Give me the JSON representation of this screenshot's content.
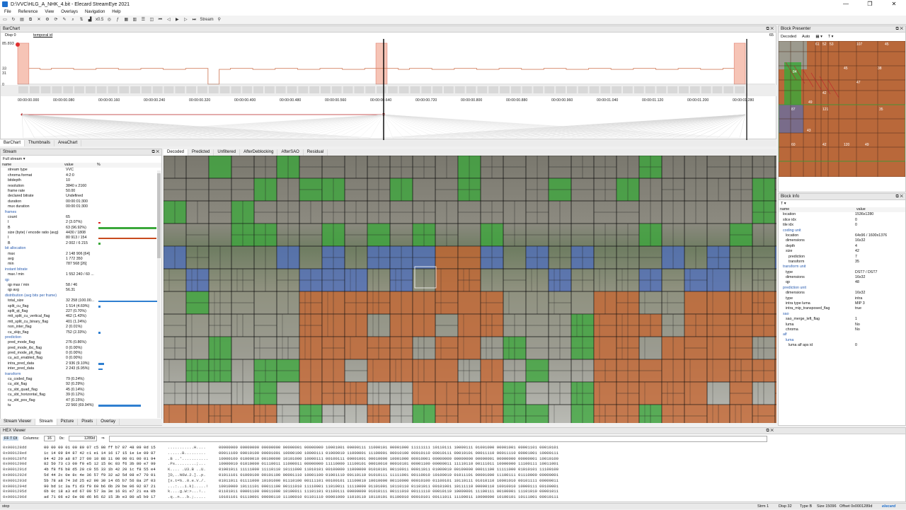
{
  "window": {
    "title": "D:\\VVC\\HLG_A_NHK_4.bit - Elecard StreamEye 2021",
    "controls": [
      "—",
      "❐",
      "✕"
    ]
  },
  "menu": [
    "File",
    "Reference",
    "View",
    "Overlays",
    "Navigation",
    "Help"
  ],
  "toolbar": {
    "zoom": "x0.5",
    "stream_label": "Stream"
  },
  "barchart": {
    "pane_title": "BarChart",
    "disp_label": "Disp 0",
    "series_label": "temporal id",
    "y_ticks": [
      "85.893",
      "33",
      "31",
      "0"
    ],
    "right_label": "65",
    "time_ticks": [
      "00:00:00.000",
      "00:00:00.080",
      "00:00:00.160",
      "00:00:00.240",
      "00:00:00.320",
      "00:00:00.400",
      "00:00:00.480",
      "00:00:00.560",
      "00:00:00.640",
      "00:00:00.720",
      "00:00:00.800",
      "00:00:00.880",
      "00:00:00.960",
      "00:00:01.040",
      "00:00:01.120",
      "00:00:01.200",
      "00:00:01.280"
    ],
    "tabs": [
      "BarChart",
      "Thumbnails",
      "AreaChart"
    ]
  },
  "chart_data": {
    "type": "bar",
    "title": "temporal id",
    "xlabel": "",
    "ylabel": "",
    "ylim": [
      0,
      85.893
    ],
    "frames": 65,
    "values": [
      85.893,
      33,
      31,
      33,
      33,
      31,
      31,
      33,
      33,
      31,
      31,
      33,
      33,
      31,
      31,
      33,
      33,
      0,
      31,
      33,
      33,
      31,
      31,
      33,
      33,
      31,
      31,
      33,
      33,
      31,
      31,
      33,
      85.893,
      33,
      31,
      33,
      33,
      31,
      31,
      33,
      33,
      31,
      31,
      33,
      33,
      31,
      31,
      33,
      33,
      31,
      31,
      33,
      33,
      31,
      31,
      33,
      33,
      31,
      31,
      33,
      33,
      31,
      31,
      33,
      85.893
    ]
  },
  "stream_panel": {
    "title": "Stream",
    "filter": "Full stream",
    "columns": [
      "name",
      "value",
      "%"
    ],
    "rows": [
      {
        "n": "stream type",
        "v": "VVC",
        "p": ""
      },
      {
        "n": "chroma format",
        "v": "4:2:0",
        "p": ""
      },
      {
        "n": "bitdepth",
        "v": "10",
        "p": ""
      },
      {
        "n": "resolution",
        "v": "3840 x 2160",
        "p": ""
      },
      {
        "n": "frame rate",
        "v": "50.00",
        "p": ""
      },
      {
        "n": "declared bitrate",
        "v": "Undefined",
        "p": ""
      },
      {
        "n": "duration",
        "v": "00:00:01:300",
        "p": ""
      },
      {
        "n": "mux duration",
        "v": "00:00:01:300",
        "p": ""
      },
      {
        "n": "frames",
        "v": "",
        "p": "",
        "sec": true
      },
      {
        "n": "count",
        "v": "65",
        "p": ""
      },
      {
        "n": "I",
        "v": "2 (3.07%)",
        "p": "",
        "dot": "#d22"
      },
      {
        "n": "B",
        "v": "63 (96.92%)",
        "p": "",
        "bar": 0.97,
        "c": "#3aa83a"
      },
      {
        "n": "size (byte) / encode ratio (avg)",
        "v": "4430 / 1808",
        "p": ""
      },
      {
        "n": "I",
        "v": "80 913 / 154",
        "p": "",
        "bar": 0.97,
        "c": "#c84b1e"
      },
      {
        "n": "B",
        "v": "2 002 / 6 215",
        "p": "",
        "dot": "#3aa83a"
      },
      {
        "n": "bit allocation",
        "v": "",
        "p": "",
        "sec": true
      },
      {
        "n": "max",
        "v": "2 148 906 [64]",
        "p": ""
      },
      {
        "n": "avg",
        "v": "1 772 350",
        "p": ""
      },
      {
        "n": "min",
        "v": "787 568 [26]",
        "p": ""
      },
      {
        "n": "instant bitrate",
        "v": "",
        "p": "",
        "sec": true
      },
      {
        "n": "max / min",
        "v": "1 552 240 / 60 ...",
        "p": ""
      },
      {
        "n": "qp",
        "v": "",
        "p": "",
        "sec": true
      },
      {
        "n": "qp max / min",
        "v": "58 / 46",
        "p": ""
      },
      {
        "n": "qp avg",
        "v": "56.31",
        "p": ""
      },
      {
        "n": "distribution (avg bits per frame)",
        "v": "",
        "p": "",
        "sec": true
      },
      {
        "n": "total_size",
        "v": "32 258 (100.00...",
        "p": "",
        "bar": 1.0,
        "c": "#2f7fd0"
      },
      {
        "n": "split_cu_flag",
        "v": "1 514 (4.69%)",
        "p": "",
        "dot": "#2f7fd0"
      },
      {
        "n": "split_qt_flag",
        "v": "227 (0.70%)",
        "p": ""
      },
      {
        "n": "mtt_split_cu_vertical_flag",
        "v": "462 (1.43%)",
        "p": ""
      },
      {
        "n": "mtt_split_cu_binary_flag",
        "v": "401 (1.24%)",
        "p": ""
      },
      {
        "n": "non_inter_flag",
        "v": "2 (0.01%)",
        "p": ""
      },
      {
        "n": "cu_skip_flag",
        "v": "752 (2.33%)",
        "p": "",
        "dot": "#2f7fd0"
      },
      {
        "n": "prediction",
        "v": "",
        "p": "",
        "sec": true
      },
      {
        "n": "pred_mode_flag",
        "v": "276 (0.86%)",
        "p": ""
      },
      {
        "n": "pred_mode_ibc_flag",
        "v": "0 (0.00%)",
        "p": ""
      },
      {
        "n": "pred_mode_plt_flag",
        "v": "0 (0.00%)",
        "p": ""
      },
      {
        "n": "cu_act_enabled_flag",
        "v": "0 (0.00%)",
        "p": ""
      },
      {
        "n": "intra_pred_data",
        "v": "2 936 (9.10%)",
        "p": "",
        "bar": 0.09,
        "c": "#2f7fd0"
      },
      {
        "n": "inter_pred_data",
        "v": "2 243 (6.95%)",
        "p": "",
        "bar": 0.07,
        "c": "#2f7fd0"
      },
      {
        "n": "transform",
        "v": "",
        "p": "",
        "sec": true
      },
      {
        "n": "cu_coded_flag",
        "v": "79 (0.24%)",
        "p": ""
      },
      {
        "n": "cu_sbt_flag",
        "v": "92 (0.29%)",
        "p": ""
      },
      {
        "n": "cu_sbt_quad_flag",
        "v": "45 (0.14%)",
        "p": ""
      },
      {
        "n": "cu_sbt_horizontal_flag",
        "v": "39 (0.12%)",
        "p": ""
      },
      {
        "n": "cu_sbt_pos_flag",
        "v": "47 (0.15%)",
        "p": ""
      },
      {
        "n": "tu",
        "v": "22 560 (69.94%)",
        "p": "",
        "bar": 0.7,
        "c": "#2f7fd0"
      }
    ],
    "bottom_tabs": [
      "Stream Viewer",
      "Stream",
      "Picture",
      "Pixels",
      "Overlay"
    ]
  },
  "picture_tabs": [
    "Decoded",
    "Predicted",
    "Unfiltered",
    "AfterDeblocking",
    "AfterSAO",
    "Residual"
  ],
  "block_presenter": {
    "title": "Block Presenter",
    "mode": "Decoded",
    "scale": "Auto",
    "labels": [
      "61",
      "52",
      "53",
      "107",
      "45",
      "45",
      "38",
      "47",
      "84",
      "42",
      "49",
      "87",
      "121",
      "35",
      "43",
      "60",
      "42",
      "120",
      "49"
    ]
  },
  "block_info": {
    "title": "Block Info",
    "columns": [
      "name",
      "value"
    ],
    "rows": [
      {
        "n": "location",
        "v": "1536x1280",
        "i": 1
      },
      {
        "n": "slice idx",
        "v": "0",
        "i": 1
      },
      {
        "n": "tile idx",
        "v": "0",
        "i": 1
      },
      {
        "n": "coding unit",
        "v": "",
        "i": 1,
        "sec": true
      },
      {
        "n": "location",
        "v": "64x96 / 1600x1376",
        "i": 2
      },
      {
        "n": "dimensions",
        "v": "16x32",
        "i": 2
      },
      {
        "n": "depth",
        "v": "4",
        "i": 2
      },
      {
        "n": "size",
        "v": "42",
        "i": 2
      },
      {
        "n": "prediction",
        "v": "7",
        "i": 3
      },
      {
        "n": "transform",
        "v": "35",
        "i": 3
      },
      {
        "n": "transform unit",
        "v": "",
        "i": 1,
        "sec": true
      },
      {
        "n": "type",
        "v": "DST7 / DST7",
        "i": 2
      },
      {
        "n": "dimensions",
        "v": "16x32",
        "i": 2
      },
      {
        "n": "qp",
        "v": "48",
        "i": 2
      },
      {
        "n": "prediction unit",
        "v": "",
        "i": 1,
        "sec": true
      },
      {
        "n": "dimensions",
        "v": "16x32",
        "i": 2
      },
      {
        "n": "type",
        "v": "intra",
        "i": 2
      },
      {
        "n": "intra type luma",
        "v": "MIP 3",
        "i": 2
      },
      {
        "n": "intra_mip_transposed_flag",
        "v": "true",
        "i": 2
      },
      {
        "n": "sao",
        "v": "",
        "i": 1,
        "sec": true
      },
      {
        "n": "sao_merge_left_flag",
        "v": "1",
        "i": 2
      },
      {
        "n": "luma",
        "v": "No",
        "i": 2
      },
      {
        "n": "chroma",
        "v": "No",
        "i": 2
      },
      {
        "n": "alf",
        "v": "",
        "i": 1,
        "sec": true
      },
      {
        "n": "luma",
        "v": "",
        "i": 2,
        "sec": true
      },
      {
        "n": "luma alf aps id",
        "v": "0",
        "i": 3
      }
    ]
  },
  "hex_viewer": {
    "title": "HEX Viewer",
    "columns_label": "Columns:",
    "columns_value": "16",
    "offset_prefix": "0x:",
    "offset_value": "1289d",
    "lines": [
      {
        "a": "0x000128dd",
        "b": "00 00 00 01 00 89 07 c5 08 ff b7 87 48 09 0d 15",
        "c": "...........H....",
        "d": "00000000 00000000 00000000 00000001 00000000 10001001 00000111 11000101 00001000 11111111 10110111 10000111 01001000 00001001 00001101 00010101"
      },
      {
        "a": "0x000128ed",
        "b": "1c 14 09 84 87 42 c1 e1 14 16 17 15 1e 1e 09 87",
        "c": "......B.........",
        "d": "00011100 00010100 00001001 10000100 10000111 01000010 11000001 11100001 00010100 00010110 00010111 00010101 00011110 00011110 00001001 10000111"
      },
      {
        "a": "0x000128fd",
        "b": "84 42 20 a8 87 27 09 10 88 11 00 00 01 00 01 94",
        "c": ".B ..'...........",
        "d": "10000100 01000010 00100000 10101000 10000111 00100111 00001001 00010000 10001000 00010001 00000000 00000000 00000001 00000000 00000001 10010100"
      },
      {
        "a": "0x0001290d",
        "b": "82 50 73 c3 00 f0 e5 12 15 0c 03 f6 3b 80 e7 99",
        "c": ".Ps.........;...",
        "d": "10000010 01010000 01110011 11000011 00000000 11110000 11100101 00010010 00010101 00001100 00000011 11110110 00111011 10000000 11100111 10011001"
      },
      {
        "a": "0x0001291d",
        "b": "4b f8 f6 b8 d5 20 c0 55 33 1b 42 20 1c f8 55 e4",
        "c": "K.... .U3.B ..U.",
        "d": "01001011 11111000 11110110 10111000 11010101 00100000 11000000 01010101 00110011 00011011 01000010 00100000 00011100 11111000 01010101 11100100"
      },
      {
        "a": "0x0001292d",
        "b": "5d 44 2c 0e 8c 4e 36 57 f9 32 a2 5d 08 e7 70 01",
        "c": "]D,..N6W.2.]..p.",
        "d": "01011101 01000100 00101100 00001110 10001100 01001110 00110110 01010111 11111001 00110010 10100010 01011101 00001000 11100111 01110000 00000001"
      },
      {
        "a": "0x0001293d",
        "b": "5b 78 a8 74 3d 25 e2 90 30 14 65 b7 56 8a 2f 03",
        "c": "[x.t=%..0.e.V./.",
        "d": "01011011 01111000 10101000 01110100 00111101 00100101 11100010 10010000 00110000 00010100 01100101 10110111 01010110 10001010 00101111 00000011"
      },
      {
        "a": "0x0001294d",
        "b": "90 bd 1c 3a f1 d3 f0 69 b6 6b 29 be 06 92 87 21",
        "c": "...:...i.k).....!",
        "d": "10010000 10111101 00011100 00111010 11110001 11010011 11110000 01101001 10110110 01101011 00101001 10111110 00000110 10010010 10000111 00100001"
      },
      {
        "a": "0x0001295d",
        "b": "6b 0c 18 a3 ed 67 00 57 3a 3e 16 81 e7 21 ea 0b",
        "c": "k....g.W:>...!..",
        "d": "01101011 00001100 00011000 10100011 11101101 01100111 00000000 01010111 00111010 00111110 00010110 10000001 11100111 00100001 11101010 00001011"
      },
      {
        "a": "0x0001296d",
        "b": "ad 71 06 e2 6e 08 d6 b5 62 15 3b e3 80 a5 b9 17",
        "c": ".q..n...b.;.....",
        "d": "10101101 01110001 00000110 11100010 01101110 00001000 11010110 10110101 01100010 00010101 00111011 11100011 10000000 10100101 10111001 00010111"
      }
    ]
  },
  "status": {
    "left": "stop",
    "strm": "Strm 1",
    "disp": "Disp 32",
    "type": "Type B",
    "size": "Size 15096",
    "offset": "Offset 0x0001289d",
    "brand": "elecard"
  },
  "colors": {
    "intra": "#c8642e",
    "skip": "#3aa83a",
    "inter": "#4f6fc0",
    "accent": "#2f7fd0",
    "brand": "#1e6fcc"
  }
}
